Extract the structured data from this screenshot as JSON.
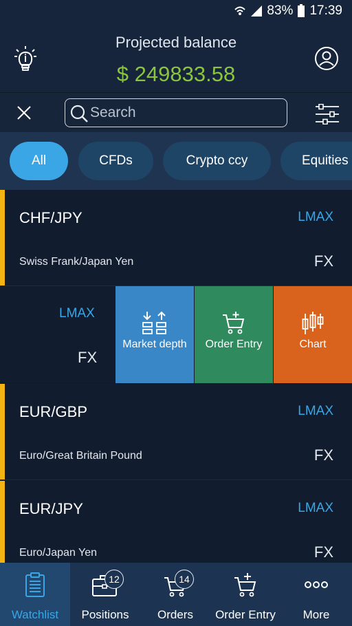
{
  "status": {
    "battery": "83%",
    "time": "17:39"
  },
  "header": {
    "title": "Projected balance",
    "balance": "$ 249833.58"
  },
  "search": {
    "placeholder": "Search"
  },
  "filters": [
    {
      "label": "All",
      "active": true
    },
    {
      "label": "CFDs",
      "active": false
    },
    {
      "label": "Crypto ccy",
      "active": false
    },
    {
      "label": "Equities",
      "active": false
    }
  ],
  "instruments": [
    {
      "symbol": "CHF/JPY",
      "venue": "LMAX",
      "description": "Swiss Frank/Japan Yen",
      "type": "FX"
    },
    {
      "symbol": "",
      "venue": "LMAX",
      "description": "",
      "type": "FX"
    },
    {
      "symbol": "EUR/GBP",
      "venue": "LMAX",
      "description": "Euro/Great Britain Pound",
      "type": "FX"
    },
    {
      "symbol": "EUR/JPY",
      "venue": "LMAX",
      "description": "Euro/Japan Yen",
      "type": "FX"
    }
  ],
  "swipe_actions": [
    {
      "label": "Market depth",
      "color": "#3a87c8",
      "icon": "market-depth-icon"
    },
    {
      "label": "Order Entry",
      "color": "#2f8a5e",
      "icon": "cart-plus-icon"
    },
    {
      "label": "Chart",
      "color": "#d9621d",
      "icon": "candlestick-icon"
    }
  ],
  "nav": [
    {
      "label": "Watchlist",
      "active": true,
      "icon": "clipboard-icon"
    },
    {
      "label": "Positions",
      "active": false,
      "icon": "briefcase-icon",
      "badge": "12"
    },
    {
      "label": "Orders",
      "active": false,
      "icon": "cart-icon",
      "badge": "14"
    },
    {
      "label": "Order Entry",
      "active": false,
      "icon": "cart-plus-icon"
    },
    {
      "label": "More",
      "active": false,
      "icon": "more-icon"
    }
  ],
  "colors": {
    "accent": "#3aa6e6",
    "balance": "#8bc53f",
    "row_marker": "#f3b312"
  }
}
